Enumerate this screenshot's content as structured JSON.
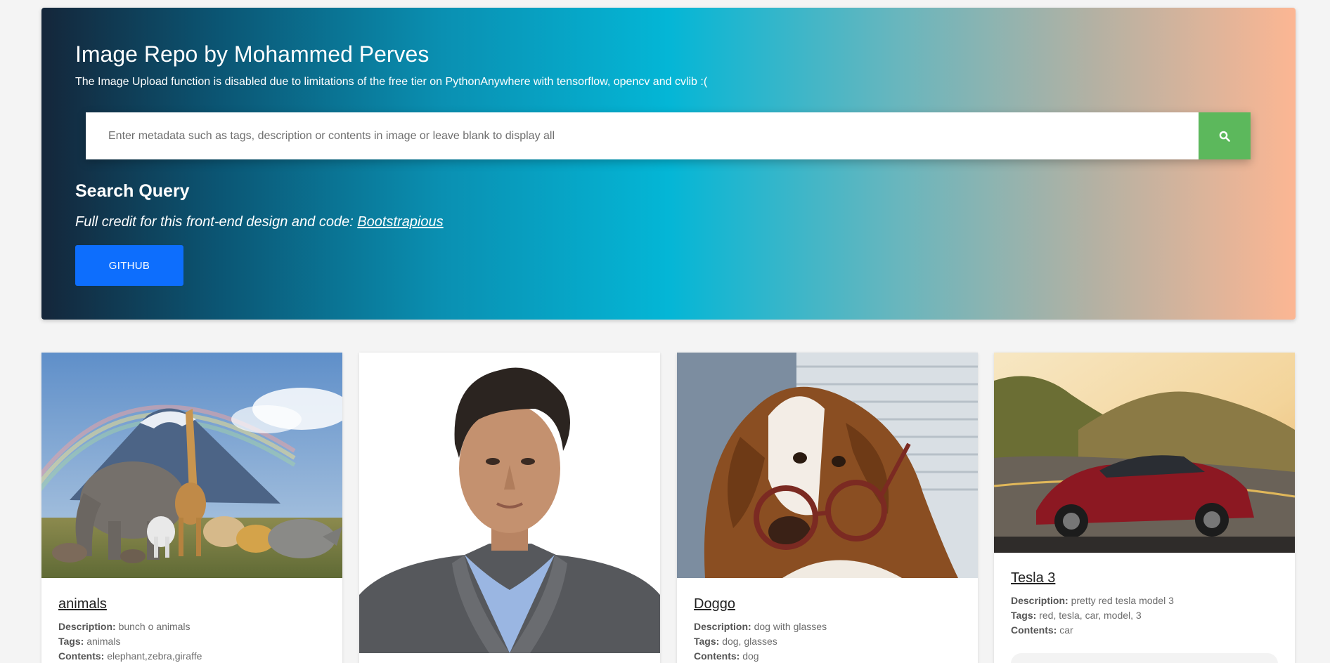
{
  "header": {
    "title": "Image Repo by Mohammed Perves",
    "notice": "The Image Upload function is disabled due to limitations of the free tier on PythonAnywhere with tensorflow, opencv and cvlib :(",
    "search_placeholder": "Enter metadata such as tags, description or contents in image or leave blank to display all",
    "search_value": "",
    "search_icon": "search-icon",
    "query_label": "Search Query",
    "credit_text": "Full credit for this front-end design and code: ",
    "credit_link": "Bootstrapious",
    "github_label": "GITHUB"
  },
  "colors": {
    "gradient": [
      "#14263a",
      "#0a90b2",
      "#04b6d6",
      "#b4b1a3",
      "#fcb693"
    ],
    "search_button": "#5cb85c",
    "github_button": "#0d6efd",
    "page_bg": "#f4f4f4"
  },
  "labels": {
    "description": "Description:",
    "tags": "Tags:",
    "contents": "Contents:"
  },
  "cards": [
    {
      "title": "animals",
      "description": "bunch o animals",
      "tags": "animals",
      "contents": "elephant,zebra,giraffe",
      "image": "animals-photo"
    },
    {
      "title": "",
      "description": "",
      "tags": "",
      "contents": "",
      "image": "portrait-photo"
    },
    {
      "title": "Doggo",
      "description": "dog with glasses",
      "tags": "dog, glasses",
      "contents": "dog",
      "image": "dog-photo"
    },
    {
      "title": "Tesla 3",
      "description": "pretty red tesla model 3",
      "tags": "red, tesla, car, model, 3",
      "contents": "car",
      "image": "car-photo"
    }
  ]
}
